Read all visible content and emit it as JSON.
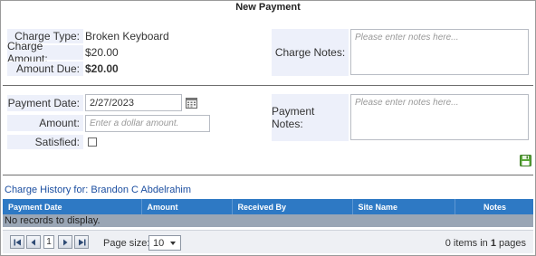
{
  "dialog": {
    "title": "New Payment"
  },
  "charge": {
    "type_label": "Charge Type:",
    "type_value": "Broken Keyboard",
    "amount_label": "Charge Amount:",
    "amount_value": "$20.00",
    "due_label": "Amount Due:",
    "due_value": "$20.00",
    "notes_label": "Charge Notes:",
    "notes_placeholder": "Please enter notes here..."
  },
  "payment": {
    "date_label": "Payment Date:",
    "date_value": "2/27/2023",
    "amount_label": "Amount:",
    "amount_placeholder": "Enter a dollar amount.",
    "satisfied_label": "Satisfied:",
    "satisfied_checked": false,
    "notes_label": "Payment Notes:",
    "notes_placeholder": "Please enter notes here..."
  },
  "icons": {
    "calendar": "calendar-icon",
    "save": "save-icon"
  },
  "history": {
    "title": "Charge History for: Brandon C Abdelrahim",
    "columns": [
      "Payment Date",
      "Amount",
      "Received By",
      "Site Name",
      "Notes"
    ],
    "empty_message": "No records to display."
  },
  "pager": {
    "first": "first-page",
    "prev": "previous-page",
    "current_page": "1",
    "next": "next-page",
    "last": "last-page",
    "page_size_label": "Page size:",
    "page_size": "10",
    "items_count": "0",
    "items_text": " items in ",
    "pages_count": "1",
    "pages_text": " pages"
  },
  "colors": {
    "header_blue": "#2e79c4",
    "label_bg": "#edf0fa",
    "empty_row": "#9aa6b5"
  }
}
